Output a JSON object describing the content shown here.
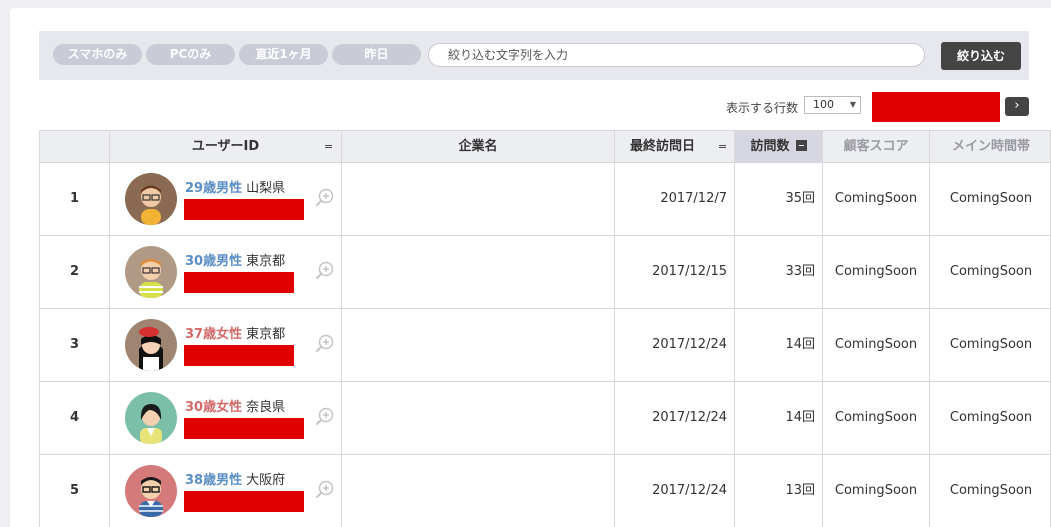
{
  "filters": {
    "chips": [
      "スマホのみ",
      "PCのみ",
      "直近1ヶ月",
      "昨日"
    ],
    "search_placeholder": "絞り込む文字列を入力",
    "apply_label": "絞り込む"
  },
  "pagination": {
    "rows_label": "表示する行数",
    "rows_value": "100",
    "next_icon": "chevron-right-icon"
  },
  "table": {
    "headers": {
      "user_id": "ユーザーID",
      "company": "企業名",
      "last_visit": "最終訪問日",
      "visits": "訪問数",
      "score": "顧客スコア",
      "main_time": "メイン時間帯"
    },
    "sort_marker": "="
  },
  "rows": [
    {
      "index": "1",
      "age_gender": "29歳男性",
      "prefecture": "山梨県",
      "gender": "male",
      "company": "",
      "last_visit": "2017/12/7",
      "visits": "35回",
      "score": "ComingSoon",
      "main_time": "ComingSoon"
    },
    {
      "index": "2",
      "age_gender": "30歳男性",
      "prefecture": "東京都",
      "gender": "male",
      "company": "",
      "last_visit": "2017/12/15",
      "visits": "33回",
      "score": "ComingSoon",
      "main_time": "ComingSoon"
    },
    {
      "index": "3",
      "age_gender": "37歳女性",
      "prefecture": "東京都",
      "gender": "female",
      "company": "",
      "last_visit": "2017/12/24",
      "visits": "14回",
      "score": "ComingSoon",
      "main_time": "ComingSoon"
    },
    {
      "index": "4",
      "age_gender": "30歳女性",
      "prefecture": "奈良県",
      "gender": "female",
      "company": "",
      "last_visit": "2017/12/24",
      "visits": "14回",
      "score": "ComingSoon",
      "main_time": "ComingSoon"
    },
    {
      "index": "5",
      "age_gender": "38歳男性",
      "prefecture": "大阪府",
      "gender": "male",
      "company": "",
      "last_visit": "2017/12/24",
      "visits": "13回",
      "score": "ComingSoon",
      "main_time": "ComingSoon"
    }
  ],
  "colors": {
    "male": "#5a8ec4",
    "female": "#d36a6a",
    "redaction": "#e00000"
  }
}
